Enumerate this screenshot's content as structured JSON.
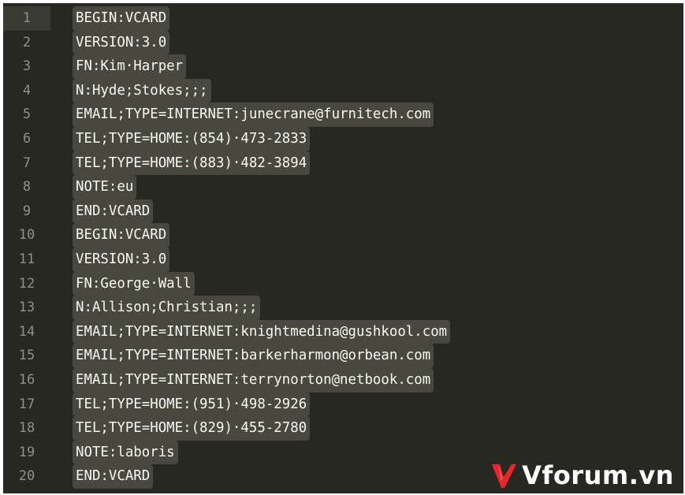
{
  "editor": {
    "lines": [
      {
        "num": "1",
        "text": "BEGIN:VCARD"
      },
      {
        "num": "2",
        "text": "VERSION:3.0"
      },
      {
        "num": "3",
        "text": "FN:Kim·Harper"
      },
      {
        "num": "4",
        "text": "N:Hyde;Stokes;;;"
      },
      {
        "num": "5",
        "text": "EMAIL;TYPE=INTERNET:junecrane@furnitech.com"
      },
      {
        "num": "6",
        "text": "TEL;TYPE=HOME:(854)·473-2833"
      },
      {
        "num": "7",
        "text": "TEL;TYPE=HOME:(883)·482-3894"
      },
      {
        "num": "8",
        "text": "NOTE:eu"
      },
      {
        "num": "9",
        "text": "END:VCARD"
      },
      {
        "num": "10",
        "text": "BEGIN:VCARD"
      },
      {
        "num": "11",
        "text": "VERSION:3.0"
      },
      {
        "num": "12",
        "text": "FN:George·Wall"
      },
      {
        "num": "13",
        "text": "N:Allison;Christian;;;"
      },
      {
        "num": "14",
        "text": "EMAIL;TYPE=INTERNET:knightmedina@gushkool.com"
      },
      {
        "num": "15",
        "text": "EMAIL;TYPE=INTERNET:barkerharmon@orbean.com"
      },
      {
        "num": "16",
        "text": "EMAIL;TYPE=INTERNET:terrynorton@netbook.com"
      },
      {
        "num": "17",
        "text": "TEL;TYPE=HOME:(951)·498-2926"
      },
      {
        "num": "18",
        "text": "TEL;TYPE=HOME:(829)·455-2780"
      },
      {
        "num": "19",
        "text": "NOTE:laboris"
      },
      {
        "num": "20",
        "text": "END:VCARD"
      }
    ]
  },
  "watermark": {
    "text": "Vforum.vn",
    "icon": "v-check-logo-icon",
    "color": "#e8252b"
  },
  "colors": {
    "background": "#272822",
    "text": "#f8f8f2",
    "selection": "#49483e",
    "gutter_text": "#8f908a"
  }
}
